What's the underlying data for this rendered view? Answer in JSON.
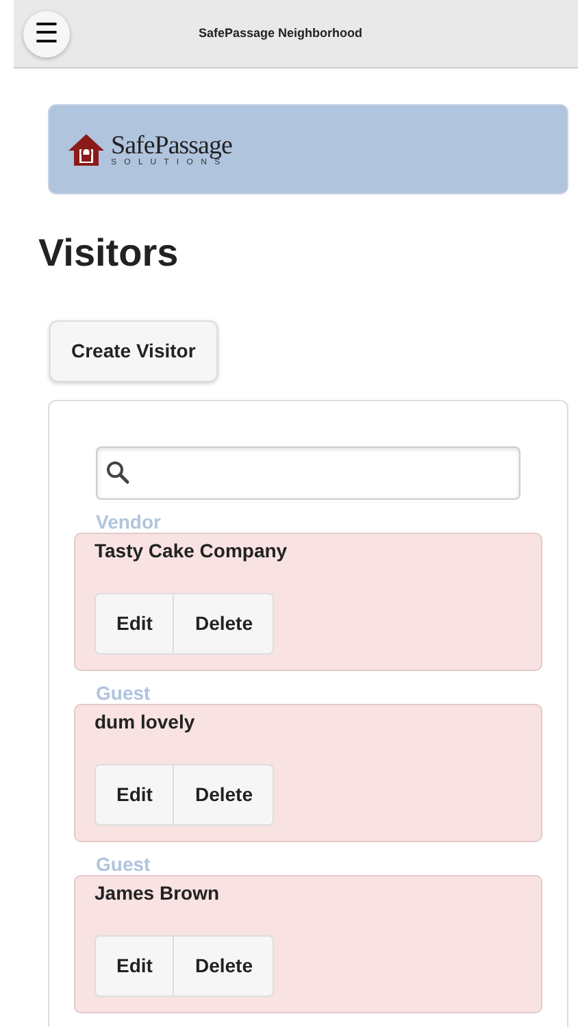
{
  "header": {
    "menu_icon": "☰",
    "title": "SafePassage Neighborhood"
  },
  "logo": {
    "name": "SafePassage",
    "tagline": "S O L U T I O N S"
  },
  "page_title": "Visitors",
  "create_button": "Create Visitor",
  "visitors": [
    {
      "category": "Vendor",
      "name": "Tasty Cake Company",
      "actions": [
        "Edit",
        "Delete"
      ]
    },
    {
      "category": "Guest",
      "name": "dum lovely",
      "actions": [
        "Edit",
        "Delete"
      ]
    },
    {
      "category": "Guest",
      "name": "James Brown",
      "actions": [
        "Edit",
        "Delete"
      ]
    }
  ]
}
